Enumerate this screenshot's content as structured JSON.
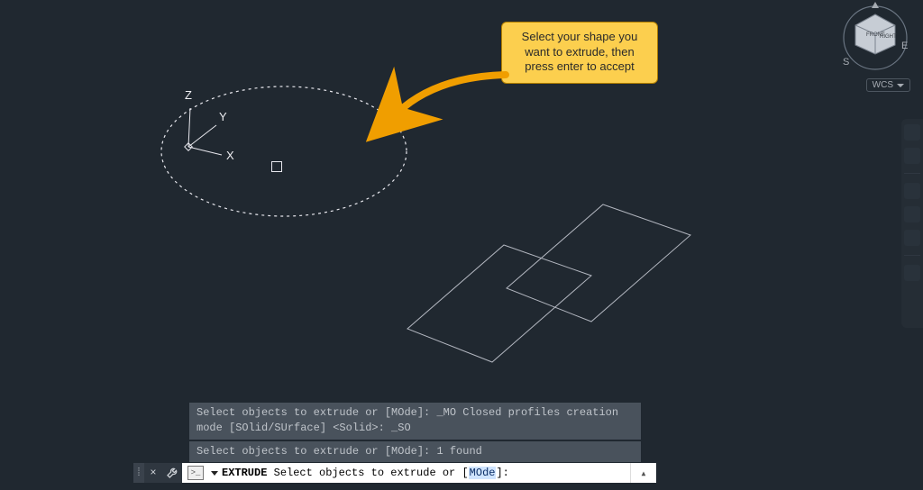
{
  "callout": {
    "text": "Select your shape you\nwant to extrude, then\npress enter to accept"
  },
  "ucs": {
    "x": "X",
    "y": "Y",
    "z": "Z"
  },
  "viewcube": {
    "front": "FRONT",
    "right": "RIGHT",
    "s": "S",
    "e": "E",
    "wcs": "WCS"
  },
  "history": {
    "line1": "Select objects to extrude or [MOde]: _MO Closed profiles creation mode [SOlid/SUrface] <Solid>: _SO",
    "line2": "Select objects to extrude or [MOde]: 1 found"
  },
  "cmd": {
    "command_name": "EXTRUDE",
    "prompt_prefix": " Select objects to extrude or [",
    "option": "MOde",
    "prompt_suffix": "]:",
    "close": "×",
    "handle_glyph": "⁞",
    "console_glyph": ">_",
    "expand_glyph": "▴"
  }
}
